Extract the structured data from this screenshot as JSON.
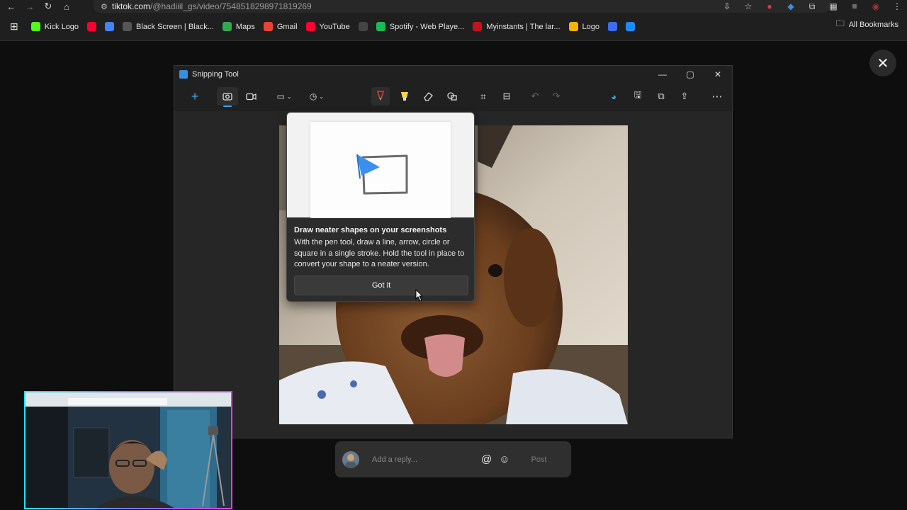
{
  "browser": {
    "url_host": "tiktok.com",
    "url_path": "/@hadiiil_gs/video/7548518298971819269",
    "bookmarks": [
      {
        "label": "Kick Logo",
        "icon": "kick-icon",
        "color": "#53fc18"
      },
      {
        "label": "",
        "icon": "youtube-icon",
        "color": "#ff0033"
      },
      {
        "label": "",
        "icon": "google-icon",
        "color": "#4285f4"
      },
      {
        "label": "Black Screen | Black...",
        "icon": "dash-icon",
        "color": "#555555"
      },
      {
        "label": "Maps",
        "icon": "maps-icon",
        "color": "#34a853"
      },
      {
        "label": "Gmail",
        "icon": "google-icon",
        "color": "#ea4335"
      },
      {
        "label": "YouTube",
        "icon": "youtube-icon",
        "color": "#ff0033"
      },
      {
        "label": "",
        "icon": "circle-icon",
        "color": "#444444"
      },
      {
        "label": "Spotify - Web Playe...",
        "icon": "spotify-icon",
        "color": "#1db954"
      },
      {
        "label": "Myinstants | The lar...",
        "icon": "myinstants-icon",
        "color": "#c0141e"
      },
      {
        "label": "Logo",
        "icon": "logo-icon",
        "color": "#f5b400"
      },
      {
        "label": "",
        "icon": "wave-icon",
        "color": "#3b6ef5"
      },
      {
        "label": "",
        "icon": "shazam-icon",
        "color": "#1a8cff"
      }
    ],
    "all_bookmarks": "All Bookmarks"
  },
  "snipping_tool": {
    "title": "Snipping Tool",
    "tip": {
      "title": "Draw neater shapes on your screenshots",
      "body": "With the pen tool, draw a line, arrow, circle or square in a single stroke. Hold the tool in place to convert your shape to a neater version.",
      "button": "Got it"
    }
  },
  "reply": {
    "placeholder": "Add a reply...",
    "post": "Post"
  },
  "colors": {
    "accent": "#4aa3e8",
    "pen_red": "#e23b3b",
    "highlighter_yellow": "#f5d63c"
  }
}
